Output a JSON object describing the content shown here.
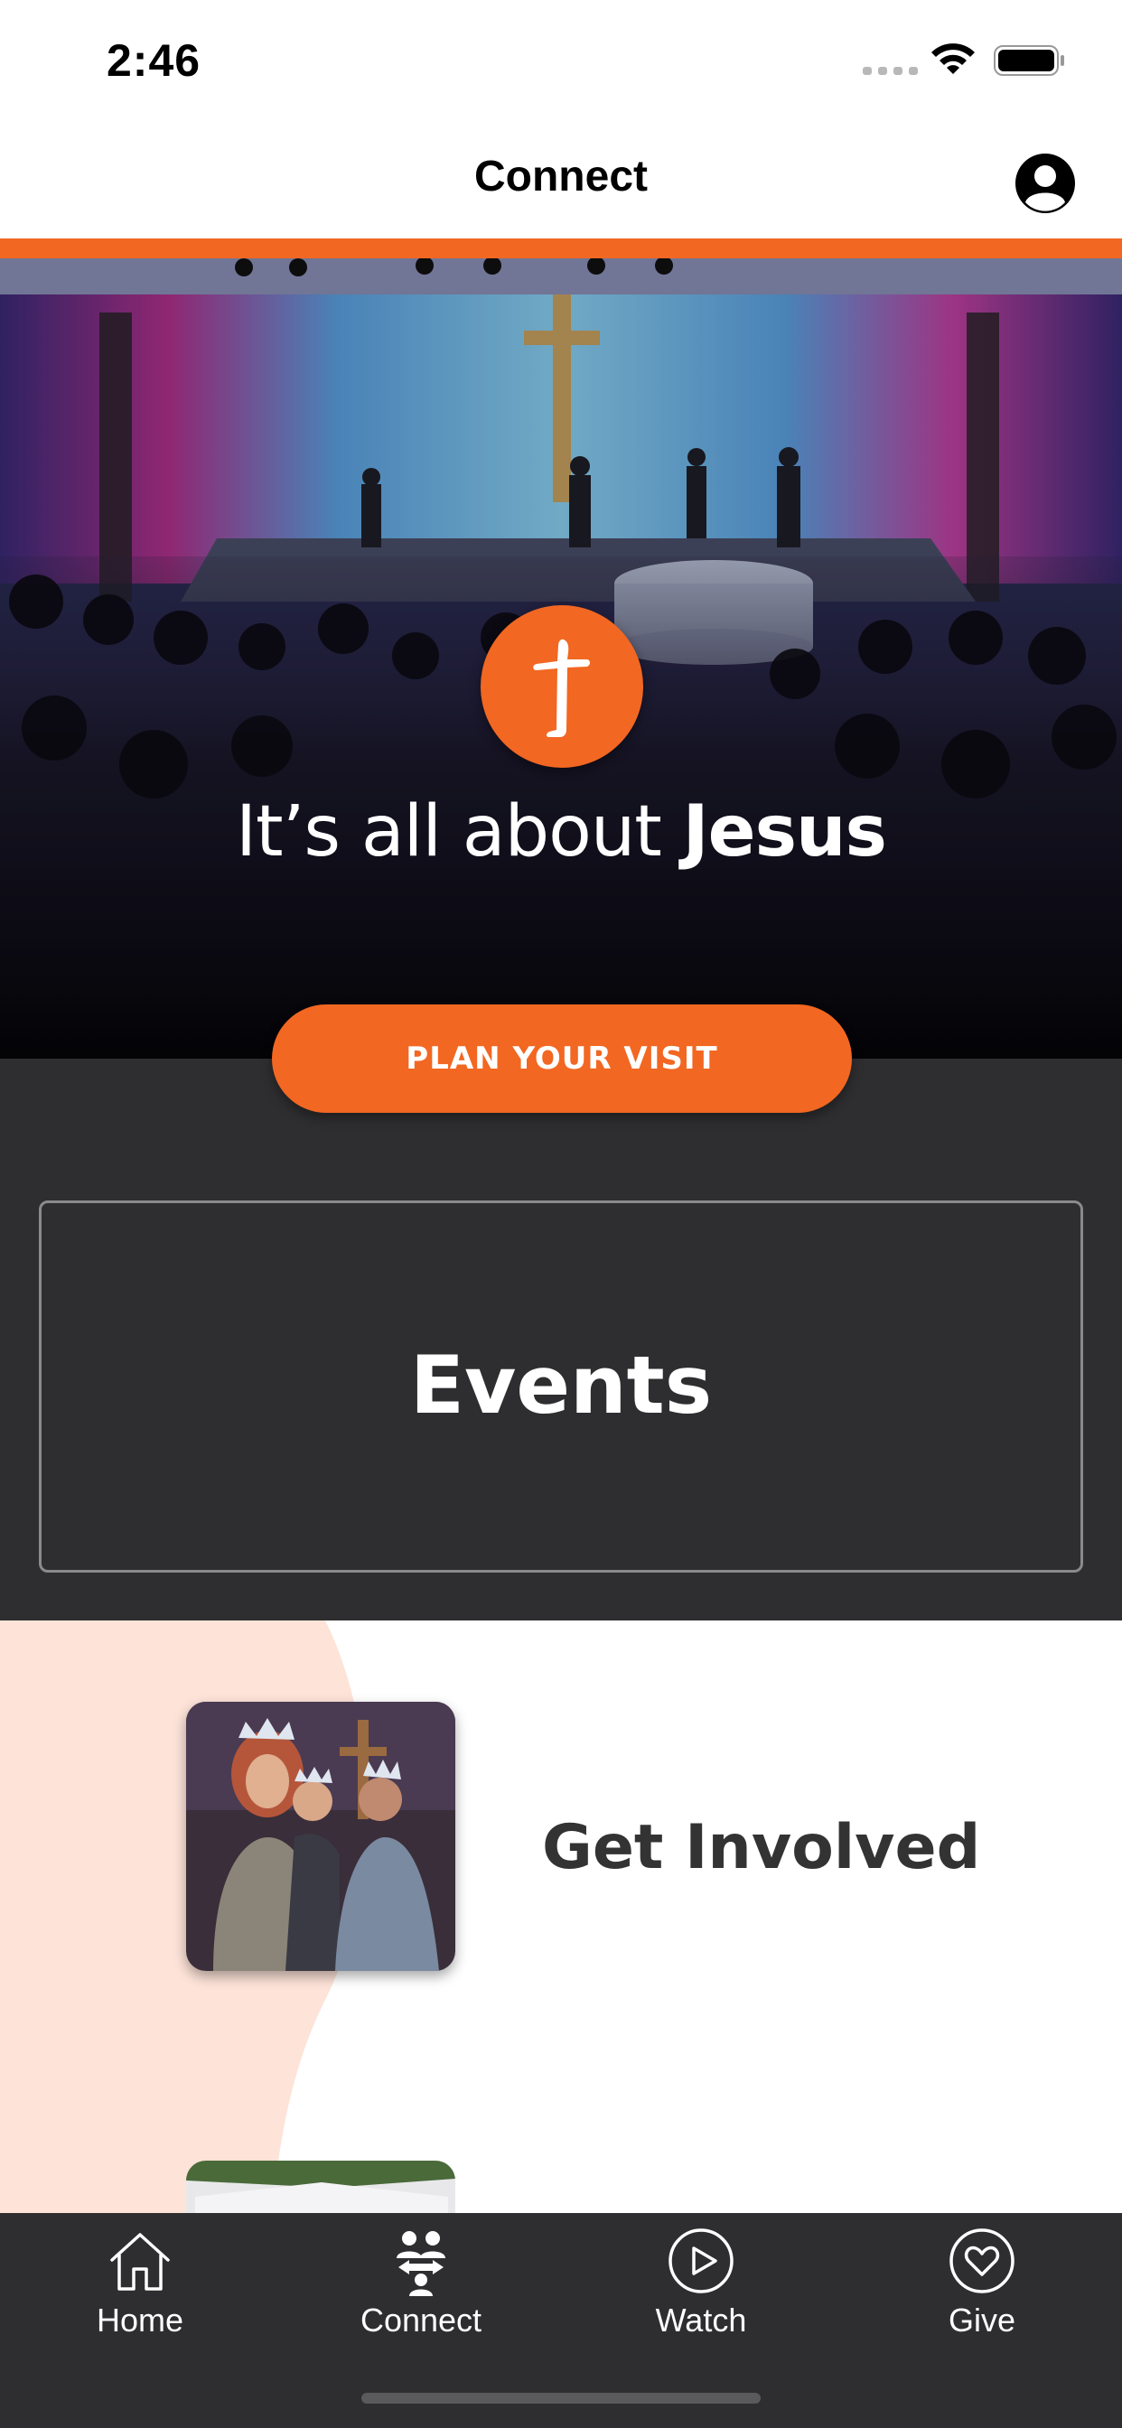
{
  "status_bar": {
    "time": "2:46"
  },
  "nav": {
    "title": "Connect"
  },
  "hero": {
    "tagline_prefix": "It’s all about ",
    "tagline_bold": "Jesus",
    "button_label": "PLAN YOUR VISIT"
  },
  "events": {
    "label": "Events"
  },
  "involved": {
    "label": "Get Involved"
  },
  "tabs": [
    {
      "label": "Home",
      "icon": "home-icon"
    },
    {
      "label": "Connect",
      "icon": "people-icon"
    },
    {
      "label": "Watch",
      "icon": "play-icon"
    },
    {
      "label": "Give",
      "icon": "heart-icon"
    }
  ],
  "colors": {
    "accent": "#f26722",
    "dark": "#2e2e30",
    "peach": "#fde3d8"
  }
}
